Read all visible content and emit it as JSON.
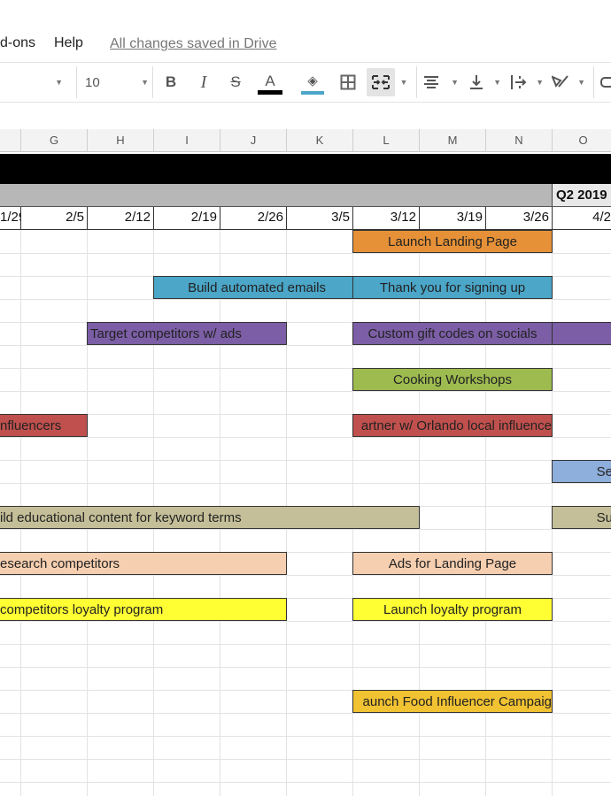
{
  "menu": {
    "items": [
      "d-ons",
      "Help"
    ],
    "save_status": "All changes saved in Drive"
  },
  "toolbar": {
    "font_size": "10",
    "bold": "B",
    "italic": "I",
    "strikethrough": "S",
    "text_color": "A",
    "text_color_value": "#000000",
    "fill_color_value": "#4ba6c8"
  },
  "columns": [
    "G",
    "H",
    "I",
    "J",
    "K",
    "L",
    "M",
    "N",
    "O"
  ],
  "quarter_label": "Q2 2019",
  "dates": [
    "1/29",
    "2/5",
    "2/12",
    "2/19",
    "2/26",
    "3/5",
    "3/12",
    "3/19",
    "3/26",
    "4/2"
  ],
  "tasks": [
    {
      "label": "Launch Landing Page",
      "color": "#e69138"
    },
    {
      "label": "Build automated emails",
      "color": "#4ba6c8"
    },
    {
      "label": "Thank you for signing up",
      "color": "#4ba6c8"
    },
    {
      "label": "Target competitors w/ ads",
      "color": "#7c5ea6"
    },
    {
      "label": "Custom gift codes on socials",
      "color": "#7c5ea6"
    },
    {
      "label": "Cooking Workshops",
      "color": "#9dbb4f"
    },
    {
      "label": "nfluencers",
      "color": "#c0504d"
    },
    {
      "label": "artner w/ Orlando local influence",
      "color": "#c0504d"
    },
    {
      "label": "Se",
      "color": "#8eaedb"
    },
    {
      "label": "ild educational content for keyword terms",
      "color": "#c5bf99"
    },
    {
      "label": "Su",
      "color": "#c5bf99"
    },
    {
      "label": "esearch competitors",
      "color": "#f6cfb0"
    },
    {
      "label": "Ads for Landing Page",
      "color": "#f6cfb0"
    },
    {
      "label": "competitors loyalty program",
      "color": "#ffff33"
    },
    {
      "label": "Launch loyalty program",
      "color": "#ffff33"
    },
    {
      "label": "aunch Food Influencer Campaig",
      "color": "#f1c232"
    }
  ]
}
